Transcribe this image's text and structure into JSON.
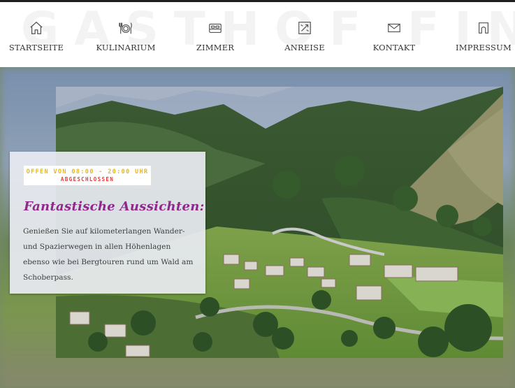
{
  "header": {
    "watermark": "GASTHOF FINK",
    "nav": [
      {
        "label": "Startseite",
        "icon": "home-icon"
      },
      {
        "label": "Kulinarium",
        "icon": "dining-icon"
      },
      {
        "label": "Zimmer",
        "icon": "bed-icon"
      },
      {
        "label": "Anreise",
        "icon": "map-icon"
      },
      {
        "label": "Kontakt",
        "icon": "mail-icon"
      },
      {
        "label": "Impressum",
        "icon": "info-icon"
      }
    ]
  },
  "card": {
    "hours_open": "OFFEN VON 08:00 - 20:00 UHR",
    "hours_status": "ABGESCHLOSSEN",
    "title": "Fantastische Aussichten:",
    "body": "Genießen Sie auf kilometerlangen Wander- und Spazierwegen in allen Höhenlagen ebenso wie bei Bergtouren rund um Wald am Schoberpass."
  },
  "colors": {
    "accent_title": "#8d2a8c",
    "hours_open": "#e5b72b",
    "hours_status": "#e63a3a"
  }
}
